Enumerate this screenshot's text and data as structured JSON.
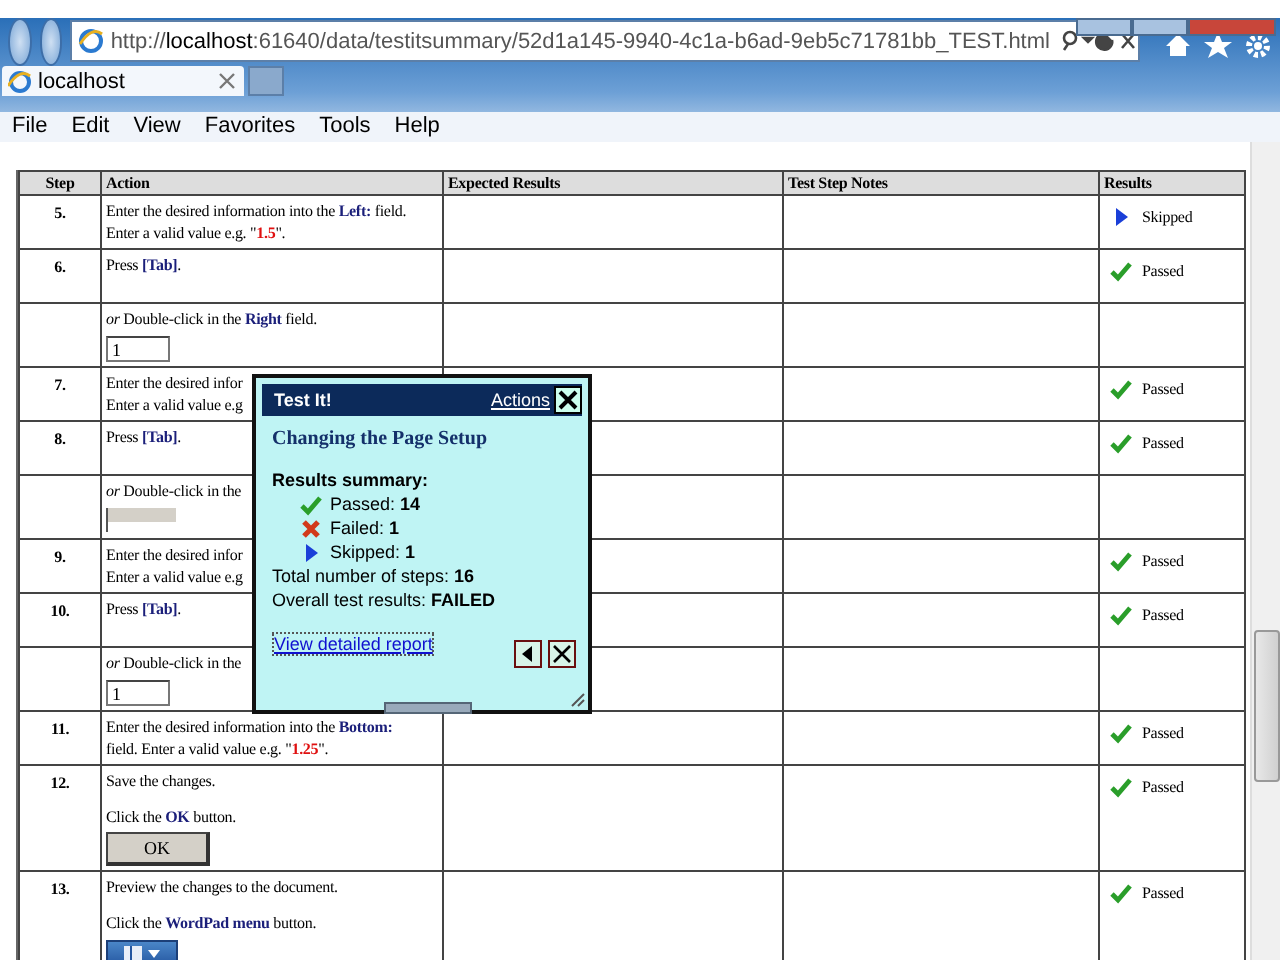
{
  "browser": {
    "url_prefix": "http://",
    "url_host": "localhost",
    "url_rest": ":61640/data/testitsummary/52d1a145-9940-4c1a-b6ad-9eb5c71781bb_TEST.html",
    "tab": "localhost",
    "menu": [
      "File",
      "Edit",
      "View",
      "Favorites",
      "Tools",
      "Help"
    ]
  },
  "table": {
    "columns": [
      "Step",
      "Action",
      "Expected Results",
      "Test Step Notes",
      "Results"
    ],
    "rows": [
      {
        "step": "5.",
        "paragraphs": [
          [
            [
              {
                "text": "Enter the desired information into the ",
                "kind": "plain"
              },
              {
                "text": "Left:",
                "kind": "ui"
              },
              {
                "text": " field.",
                "kind": "plain"
              }
            ],
            [
              {
                "text": "Enter a valid value e.g. \"",
                "kind": "plain"
              },
              {
                "text": "1.5",
                "kind": "value"
              },
              {
                "text": "\".",
                "kind": "plain"
              }
            ]
          ]
        ],
        "result": {
          "kind": "skipped",
          "label": "Skipped"
        }
      },
      {
        "step": "6.",
        "paragraphs": [
          [
            [
              {
                "text": "Press ",
                "kind": "plain"
              },
              {
                "text": "[Tab]",
                "kind": "ui"
              },
              {
                "text": ".",
                "kind": "plain"
              }
            ]
          ]
        ],
        "result": {
          "kind": "passed",
          "label": "Passed"
        }
      },
      {
        "step": "",
        "paragraphs": [
          [
            [
              {
                "text": "or",
                "kind": "italic"
              },
              {
                "text": " Double-click in the ",
                "kind": "plain"
              },
              {
                "text": "Right",
                "kind": "ui"
              },
              {
                "text": " field.",
                "kind": "plain"
              }
            ]
          ]
        ],
        "field": {
          "kind": "input",
          "value": "1"
        }
      },
      {
        "step": "7.",
        "paragraphs": [
          [
            [
              {
                "text": "Enter the desired infor",
                "kind": "plain"
              }
            ],
            [
              {
                "text": "Enter a valid value e.g",
                "kind": "plain"
              }
            ]
          ]
        ],
        "result": {
          "kind": "passed",
          "label": "Passed"
        }
      },
      {
        "step": "8.",
        "paragraphs": [
          [
            [
              {
                "text": "Press ",
                "kind": "plain"
              },
              {
                "text": "[Tab]",
                "kind": "ui"
              },
              {
                "text": ".",
                "kind": "plain"
              }
            ]
          ]
        ],
        "result": {
          "kind": "passed",
          "label": "Passed"
        }
      },
      {
        "step": "",
        "paragraphs": [
          [
            [
              {
                "text": "or",
                "kind": "italic"
              },
              {
                "text": " Double-click in the",
                "kind": "plain"
              }
            ]
          ]
        ],
        "field": {
          "kind": "clipped"
        }
      },
      {
        "step": "9.",
        "paragraphs": [
          [
            [
              {
                "text": "Enter the desired infor",
                "kind": "plain"
              }
            ],
            [
              {
                "text": "Enter a valid value e.g",
                "kind": "plain"
              }
            ]
          ]
        ],
        "result": {
          "kind": "passed",
          "label": "Passed"
        }
      },
      {
        "step": "10.",
        "paragraphs": [
          [
            [
              {
                "text": "Press ",
                "kind": "plain"
              },
              {
                "text": "[Tab]",
                "kind": "ui"
              },
              {
                "text": ".",
                "kind": "plain"
              }
            ]
          ]
        ],
        "result": {
          "kind": "passed",
          "label": "Passed"
        }
      },
      {
        "step": "",
        "paragraphs": [
          [
            [
              {
                "text": "or",
                "kind": "italic"
              },
              {
                "text": " Double-click in the",
                "kind": "plain"
              }
            ]
          ]
        ],
        "field": {
          "kind": "input",
          "value": "1"
        }
      },
      {
        "step": "11.",
        "paragraphs": [
          [
            [
              {
                "text": "Enter the desired information into the ",
                "kind": "plain"
              },
              {
                "text": "Bottom:",
                "kind": "ui"
              }
            ],
            [
              {
                "text": "field. Enter a valid value e.g. \"",
                "kind": "plain"
              },
              {
                "text": "1.25",
                "kind": "value"
              },
              {
                "text": "\".",
                "kind": "plain"
              }
            ]
          ]
        ],
        "result": {
          "kind": "passed",
          "label": "Passed"
        }
      },
      {
        "step": "12.",
        "paragraphs": [
          [
            [
              {
                "text": "Save the changes.",
                "kind": "plain"
              }
            ]
          ],
          [
            [
              {
                "text": "Click the ",
                "kind": "plain"
              },
              {
                "text": "OK",
                "kind": "ui"
              },
              {
                "text": " button.",
                "kind": "plain"
              }
            ]
          ]
        ],
        "button": {
          "label": "OK"
        },
        "result": {
          "kind": "passed",
          "label": "Passed"
        }
      },
      {
        "step": "13.",
        "paragraphs": [
          [
            [
              {
                "text": "Preview the changes to the document.",
                "kind": "plain"
              }
            ]
          ],
          [
            [
              {
                "text": "Click the ",
                "kind": "plain"
              },
              {
                "text": "WordPad menu",
                "kind": "ui"
              },
              {
                "text": " button.",
                "kind": "plain"
              }
            ]
          ]
        ],
        "menu_button": {
          "kind": "dropdown"
        },
        "result": {
          "kind": "passed",
          "label": "Passed"
        }
      }
    ]
  },
  "popup": {
    "title": "Test It!",
    "actions": "Actions",
    "heading": "Changing the Page Setup",
    "summary_label": "Results summary:",
    "summary": [
      {
        "kind": "passed",
        "label": "Passed:",
        "count": "14"
      },
      {
        "kind": "failed",
        "label": "Failed:",
        "count": "1"
      },
      {
        "kind": "skipped",
        "label": "Skipped:",
        "count": "1"
      }
    ],
    "total_label": "Total number of steps:",
    "total": "16",
    "overall_label": "Overall test results:",
    "overall": "FAILED",
    "link": "View detailed report"
  }
}
